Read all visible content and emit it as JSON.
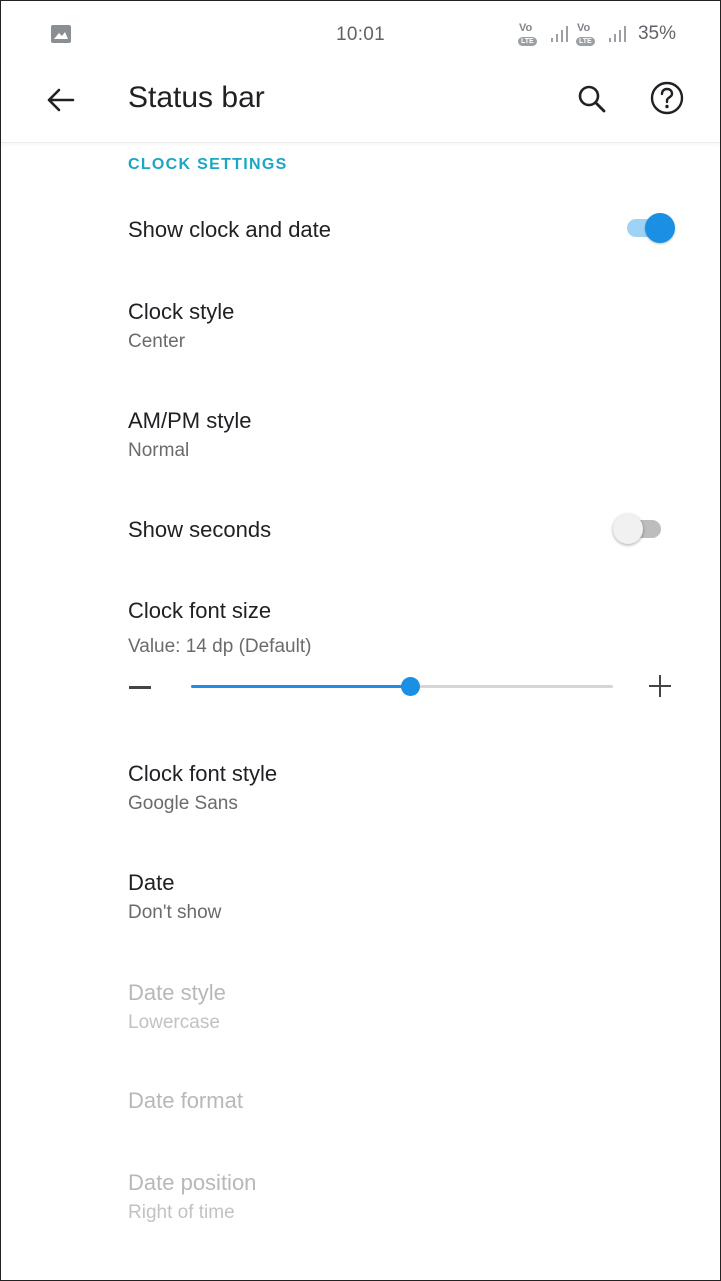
{
  "status_bar": {
    "time": "10:01",
    "volte_label": "Vo",
    "lte_label": "LTE",
    "battery": "35%"
  },
  "app_bar": {
    "title": "Status bar",
    "icons": [
      "back-arrow-icon",
      "search-icon",
      "help-icon"
    ]
  },
  "section": {
    "header": "CLOCK SETTINGS"
  },
  "preferences": {
    "show_clock": {
      "title": "Show clock and date",
      "enabled": true
    },
    "clock_style": {
      "title": "Clock style",
      "summary": "Center"
    },
    "ampm_style": {
      "title": "AM/PM style",
      "summary": "Normal"
    },
    "show_seconds": {
      "title": "Show seconds",
      "enabled": false
    },
    "font_size": {
      "title": "Clock font size",
      "summary": "Value: 14 dp (Default)",
      "slider_fraction": 0.52
    },
    "font_style": {
      "title": "Clock font style",
      "summary": "Google Sans"
    },
    "date": {
      "title": "Date",
      "summary": "Don't show"
    },
    "date_style": {
      "title": "Date style",
      "summary": "Lowercase"
    },
    "date_format": {
      "title": "Date format"
    },
    "date_position": {
      "title": "Date position",
      "summary": "Right of time"
    }
  },
  "colors": {
    "accent": "#1a8fe3",
    "section_header": "#1ba6c4",
    "switch_track_on": "#9fd3f6"
  }
}
